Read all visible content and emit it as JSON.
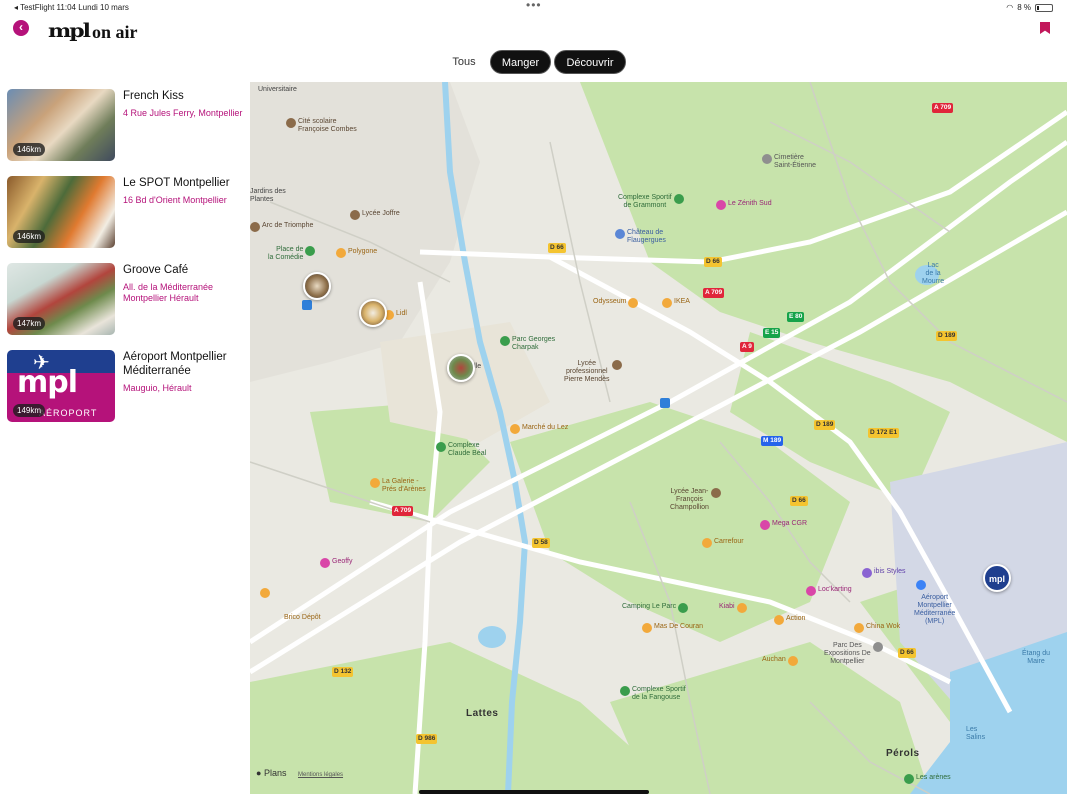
{
  "status": {
    "left": "◂ TestFlight   11:04   Lundi 10 mars",
    "dots": "•••",
    "battery": "8 %"
  },
  "header": {
    "back_symbol": "‹",
    "logo_mpl": "mpl",
    "logo_onair": "on air"
  },
  "tabs": {
    "all": "Tous",
    "eat": "Manger",
    "discover": "Découvrir"
  },
  "places": [
    {
      "name": "French Kiss",
      "address": "4 Rue Jules Ferry, Montpellier",
      "distance": "146km"
    },
    {
      "name": "Le SPOT Montpellier",
      "address": "16 Bd d'Orient Montpellier",
      "distance": "146km"
    },
    {
      "name": "Groove Café",
      "address": "All. de la Méditerranée Montpellier Hérault",
      "distance": "147km"
    },
    {
      "name": "Aéroport Montpellier Méditerranée",
      "address": "Mauguio, Hérault",
      "distance": "149km",
      "thumb_text": "mpl",
      "thumb_sub": "AÉROPORT"
    }
  ],
  "map": {
    "labels": {
      "universitaire": "Universitaire",
      "cite": "Cité scolaire\nFrançoise Combes",
      "jardins": "Jardins des\nPlantes",
      "arc": "Arc de Triomphe",
      "place": "Place de\nla Comédie",
      "polygone": "Polygone",
      "lycee_joffre": "Lycée Joffre",
      "lidl": "Lidl",
      "ville": "Ville",
      "parc_charpak": "Parc Georges\nCharpak",
      "lycee_mendes": "Lycée\nprofessionnel\nPierre Mendès",
      "odysseum": "Odysseum",
      "ikea": "IKEA",
      "complexe_gram": "Complexe Sportif\nde Grammont",
      "chateau": "Château de\nFlaugergues",
      "zenith": "Le Zénith Sud",
      "cimetiere": "Cimetière\nSaint-Étienne",
      "lac_mourre": "Lac\nde la\nMourre",
      "marche_lez": "Marché du Lez",
      "complexe_beal": "Complexe\nClaude Béal",
      "galerie": "La Galerie -\nPrés d'Arènes",
      "lycee_champollion": "Lycée Jean-\nFrançois\nChampollion",
      "mega_cgr": "Mega CGR",
      "carrefour": "Carrefour",
      "ibis": "ibis Styles",
      "geoffy": "Geoffy",
      "brico": "Brico Dépôt",
      "camping": "Camping Le Parc",
      "kiabi": "Kiabi",
      "loc_karting": "Loc'karting",
      "action": "Action",
      "mas": "Mas De Couran",
      "china": "China Wok",
      "auchan": "Auchan",
      "parc_expo": "Parc Des\nExpositions De\nMontpellier",
      "aeroport": "Aéroport\nMontpellier\nMéditerranée\n(MPL)",
      "etang": "Étang du\nMaire",
      "salins": "Les\nSalins",
      "complexe_fangouse": "Complexe Sportif\nde la Fangouse",
      "arenes": "Les arènes"
    },
    "towns": {
      "lattes": "Lattes",
      "perols": "Pérols"
    },
    "roads": {
      "d66_a": "D 66",
      "d66_b": "D 66",
      "d66_c": "D 66",
      "d66_d": "D 66",
      "a709_a": "A 709",
      "a709_b": "A 709",
      "a709_c": "A 709",
      "e80": "E 80",
      "e15": "E 15",
      "a9": "A 9",
      "m189": "M 189",
      "d189_a": "D 189",
      "d189_b": "D 189",
      "d172": "D 172 E1",
      "d58": "D 58",
      "d132": "D 132",
      "d986": "D 986"
    },
    "attribution": "Plans",
    "legal": "Mentions légales",
    "airport_pin": "mpl"
  },
  "colors": {
    "accent": "#b5127a",
    "park": "#b9dc9a",
    "water": "#9ed2ee",
    "road": "#ffffff"
  }
}
